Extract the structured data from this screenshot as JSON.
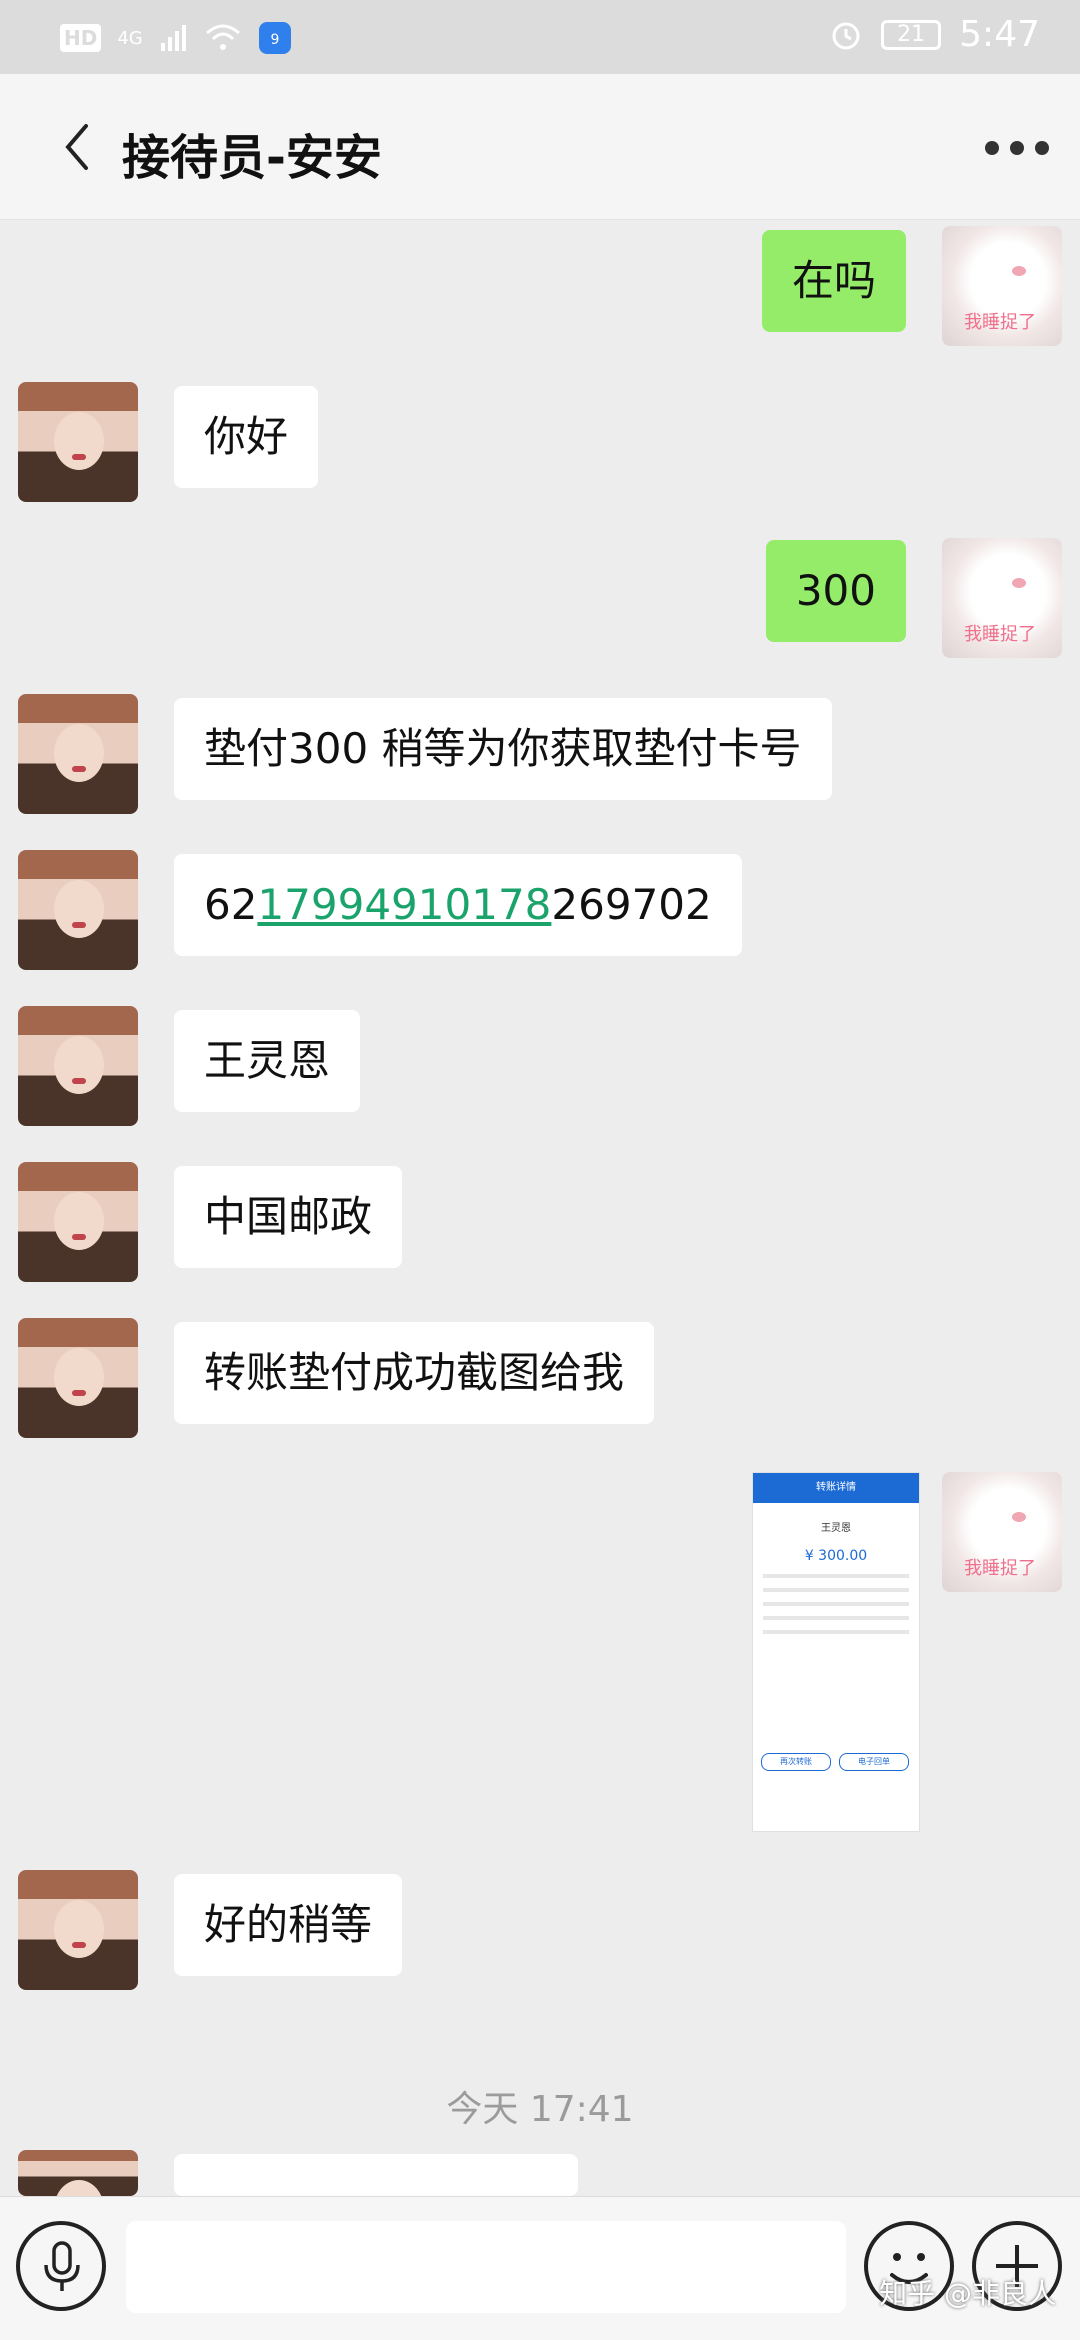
{
  "status_bar": {
    "hd": "HD",
    "network": "4G",
    "battery": "21",
    "time": "5:47"
  },
  "header": {
    "title": "接待员-安安"
  },
  "messages": [
    {
      "side": "right",
      "text": "在吗"
    },
    {
      "side": "left",
      "text": "你好"
    },
    {
      "side": "right",
      "text": "300"
    },
    {
      "side": "left",
      "text": "垫付300 稍等为你获取垫付卡号"
    },
    {
      "side": "left",
      "text_prefix": "62",
      "text_link": "17994910178",
      "text_suffix": "269702"
    },
    {
      "side": "left",
      "text": "王灵恩"
    },
    {
      "side": "left",
      "text": "中国邮政"
    },
    {
      "side": "left",
      "text": "转账垫付成功截图给我"
    },
    {
      "side": "right",
      "type": "image",
      "img_title": "转账详情",
      "img_name": "王灵恩",
      "img_amount": "¥ 300.00",
      "img_btn1": "再次转账",
      "img_btn2": "电子回单"
    },
    {
      "side": "left",
      "text": "好的稍等"
    }
  ],
  "cat_avatar_text": "我睡捉了",
  "time_divider": "今天 17:41",
  "watermark": "知乎 @非良人",
  "colors": {
    "bubble_right": "#95ec69",
    "bubble_left": "#ffffff",
    "background": "#ededed",
    "link": "#1aa36b"
  }
}
